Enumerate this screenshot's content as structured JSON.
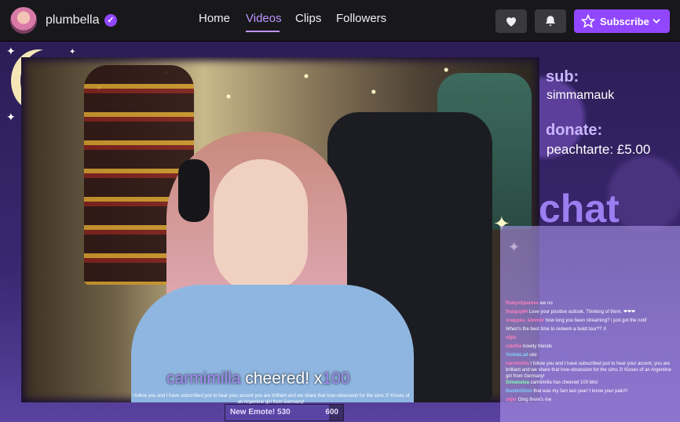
{
  "header": {
    "channel_name": "plumbella",
    "verified_mark": "✓",
    "tabs": [
      {
        "label": "Home",
        "active": false
      },
      {
        "label": "Videos",
        "active": true
      },
      {
        "label": "Clips",
        "active": false
      },
      {
        "label": "Followers",
        "active": false
      }
    ],
    "subscribe_label": "Subscribe",
    "icons": {
      "follow": "heart-icon",
      "notifications": "bell-icon",
      "subscribe": "star-icon",
      "dropdown": "chevron-down-icon"
    }
  },
  "overlay": {
    "sub_label": "sub:",
    "sub_value": "simmamauk",
    "donate_label": "donate:",
    "donate_value": "peachtarte: £5.00",
    "chat_title": "chat",
    "cheer_user": "carmimilla",
    "cheer_text": "cheered! x",
    "cheer_amount": "100",
    "cheer_message": "I follow you and I have subscribed just to hear your accent you are brilliant and we share that love-obsession for the sims 2! Kisses of an Argentine girl from Germany!",
    "goal_label": "New Emote! 530",
    "goal_target": "600",
    "goal_progress": 0.883
  },
  "chat": [
    {
      "user": "RobynSparkes",
      "color": "#ff7fbf",
      "text": "ew no"
    },
    {
      "user": "thalguy84",
      "color": "#ff7fbf",
      "text": "Love your positive outlook. Thinking of them. ❤❤❤"
    },
    {
      "user": "snappea_simmer",
      "color": "#ff7fbf",
      "text": "how long you been streaming? i just got the notif"
    },
    {
      "user": "",
      "color": "#ff7fbf",
      "text": "When's the best time to redeem a build tour?? X"
    },
    {
      "user": "skjkr",
      "color": "#ff7fbf",
      "text": ""
    },
    {
      "user": "rubitha",
      "color": "#ff7fbf",
      "text": "howdy friends"
    },
    {
      "user": "YorkieLad",
      "color": "#7fd0ff",
      "text": "oioi"
    },
    {
      "user": "carmimilla",
      "color": "#ff7fbf",
      "text": "I follow you and I have subscribed just to hear your accent, you are brilliant and we share that love-obsession for the sims 2! Kisses of an Argentine girl from Germany!"
    },
    {
      "user": "Simanatsa",
      "color": "#7fffb0",
      "text": "carmimilla has cheered 100 bits!"
    },
    {
      "user": "DustinStinn",
      "color": "#7fd0ff",
      "text": "that was my fam last year! I know your pain!!!"
    },
    {
      "user": "skjkr",
      "color": "#ff7fbf",
      "text": "Omg there's me"
    }
  ],
  "colors": {
    "accent": "#9147ff",
    "active_tab": "#bf94ff",
    "overlay_purple": "#9b7ef0"
  }
}
